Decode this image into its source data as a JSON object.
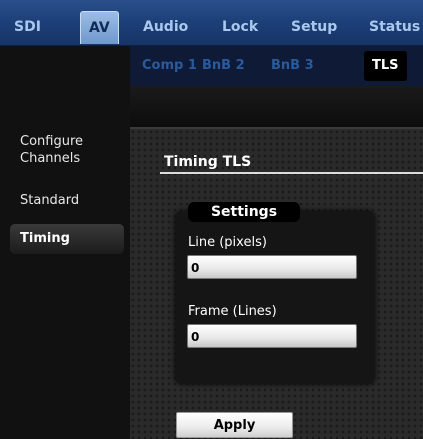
{
  "top_tabs": [
    {
      "label": "SDI"
    },
    {
      "label": "AV"
    },
    {
      "label": "Audio"
    },
    {
      "label": "Lock"
    },
    {
      "label": "Setup"
    },
    {
      "label": "Status"
    }
  ],
  "sub_tabs": [
    {
      "label": "Comp 1"
    },
    {
      "label": "BnB 2"
    },
    {
      "label": "BnB 3"
    },
    {
      "label": "TLS"
    }
  ],
  "sidebar": {
    "items": [
      {
        "label_line1": "Configure",
        "label_line2": "Channels"
      },
      {
        "label": "Standard"
      },
      {
        "label": "Timing"
      }
    ]
  },
  "main": {
    "section_title": "Timing TLS",
    "group_title": "Settings",
    "fields": [
      {
        "label": "Line (pixels)",
        "value": "0"
      },
      {
        "label": "Frame (Lines)",
        "value": "0"
      }
    ],
    "apply_label": "Apply"
  },
  "colors": {
    "tab_bar": "#1d3f78",
    "active_tab": "#7fa6d6",
    "sub_tab_text": "#2a5a9e"
  }
}
